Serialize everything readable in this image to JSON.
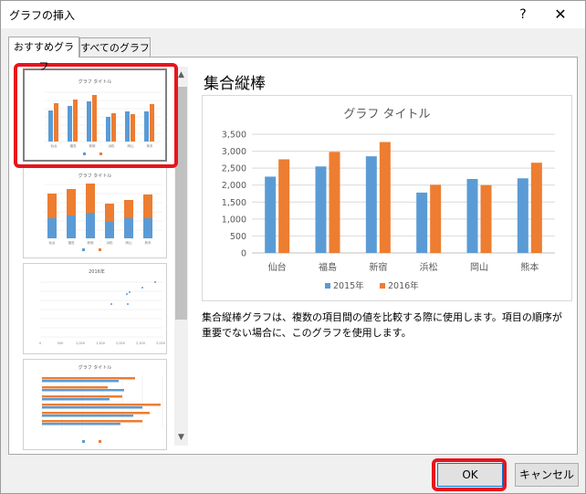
{
  "dialog": {
    "title": "グラフの挿入",
    "help_label": "?",
    "close_label": "✕"
  },
  "tabs": [
    {
      "label": "おすすめグラフ",
      "active": true
    },
    {
      "label": "すべてのグラフ",
      "active": false
    }
  ],
  "selected_chart": {
    "name": "集合縦棒",
    "description": "集合縦棒グラフは、複数の項目間の値を比較する際に使用します。項目の順序が重要でない場合に、このグラフを使用します。"
  },
  "thumbnails": [
    {
      "title": "グラフ タイトル",
      "kind": "clustered-column"
    },
    {
      "title": "グラフ タイトル",
      "kind": "stacked-column"
    },
    {
      "title": "2016年",
      "kind": "scatter"
    },
    {
      "title": "グラフ タイトル",
      "kind": "clustered-bar"
    }
  ],
  "chart_data": {
    "type": "bar",
    "title": "グラフ タイトル",
    "categories": [
      "仙台",
      "福島",
      "新宿",
      "浜松",
      "岡山",
      "熊本"
    ],
    "series": [
      {
        "name": "2015年",
        "values": [
          2250,
          2550,
          2850,
          1780,
          2180,
          2200
        ],
        "color": "#5b9bd5"
      },
      {
        "name": "2016年",
        "values": [
          2760,
          2980,
          3270,
          2010,
          2000,
          2660
        ],
        "color": "#ed7d31"
      }
    ],
    "ylim": [
      0,
      3500
    ],
    "yticks": [
      "0",
      "500",
      "1,000",
      "1,500",
      "2,000",
      "2,500",
      "3,000",
      "3,500"
    ],
    "grid": true,
    "legend": "bottom"
  },
  "buttons": {
    "ok": "OK",
    "cancel": "キャンセル"
  },
  "colors": {
    "highlight": "#e8141c",
    "series1": "#5b9bd5",
    "series2": "#ed7d31"
  }
}
